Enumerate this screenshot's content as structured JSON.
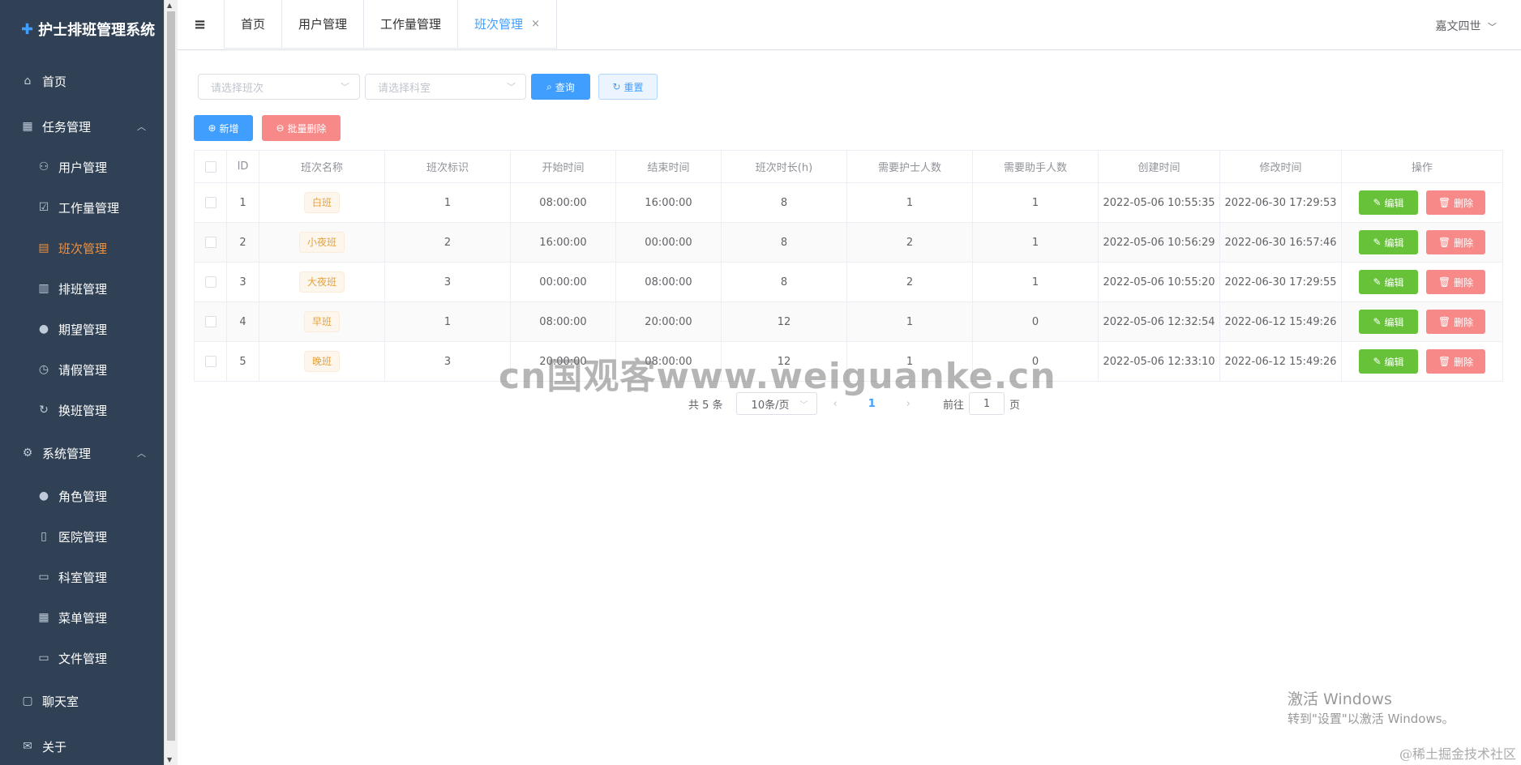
{
  "app": {
    "title": "护士排班管理系统",
    "user": "嘉文四世"
  },
  "sidebar": {
    "items": [
      {
        "label": "首页",
        "icon": "home-icon"
      },
      {
        "label": "任务管理",
        "icon": "grid-icon"
      },
      {
        "label": "用户管理",
        "icon": "user-icon"
      },
      {
        "label": "工作量管理",
        "icon": "clipboard-check-icon"
      },
      {
        "label": "班次管理",
        "icon": "clipboard-icon"
      },
      {
        "label": "排班管理",
        "icon": "calendar-icon"
      },
      {
        "label": "期望管理",
        "icon": "location-icon"
      },
      {
        "label": "请假管理",
        "icon": "clock-icon"
      },
      {
        "label": "换班管理",
        "icon": "refresh-icon"
      },
      {
        "label": "系统管理",
        "icon": "gear-icon"
      },
      {
        "label": "角色管理",
        "icon": "person-icon"
      },
      {
        "label": "医院管理",
        "icon": "building-icon"
      },
      {
        "label": "科室管理",
        "icon": "office-icon"
      },
      {
        "label": "菜单管理",
        "icon": "menu-icon"
      },
      {
        "label": "文件管理",
        "icon": "folder-icon"
      },
      {
        "label": "聊天室",
        "icon": "chat-icon"
      },
      {
        "label": "关于",
        "icon": "mail-icon"
      }
    ]
  },
  "tabs": [
    {
      "label": "首页"
    },
    {
      "label": "用户管理"
    },
    {
      "label": "工作量管理"
    },
    {
      "label": "班次管理"
    }
  ],
  "filters": {
    "shift_placeholder": "请选择班次",
    "dept_placeholder": "请选择科室",
    "query_label": "查询",
    "reset_label": "重置"
  },
  "actions": {
    "add_label": "新增",
    "batch_delete_label": "批量删除"
  },
  "table": {
    "headers": [
      "ID",
      "班次名称",
      "班次标识",
      "开始时间",
      "结束时间",
      "班次时长(h)",
      "需要护士人数",
      "需要助手人数",
      "创建时间",
      "修改时间",
      "操作"
    ],
    "edit_label": "编辑",
    "delete_label": "删除",
    "rows": [
      {
        "id": "1",
        "name": "白班",
        "flag": "1",
        "start": "08:00:00",
        "end": "16:00:00",
        "hours": "8",
        "nurses": "1",
        "assistants": "1",
        "created": "2022-05-06 10:55:35",
        "modified": "2022-06-30 17:29:53"
      },
      {
        "id": "2",
        "name": "小夜班",
        "flag": "2",
        "start": "16:00:00",
        "end": "00:00:00",
        "hours": "8",
        "nurses": "2",
        "assistants": "1",
        "created": "2022-05-06 10:56:29",
        "modified": "2022-06-30 16:57:46"
      },
      {
        "id": "3",
        "name": "大夜班",
        "flag": "3",
        "start": "00:00:00",
        "end": "08:00:00",
        "hours": "8",
        "nurses": "2",
        "assistants": "1",
        "created": "2022-05-06 10:55:20",
        "modified": "2022-06-30 17:29:55"
      },
      {
        "id": "4",
        "name": "早班",
        "flag": "1",
        "start": "08:00:00",
        "end": "20:00:00",
        "hours": "12",
        "nurses": "1",
        "assistants": "0",
        "created": "2022-05-06 12:32:54",
        "modified": "2022-06-12 15:49:26"
      },
      {
        "id": "5",
        "name": "晚班",
        "flag": "3",
        "start": "20:00:00",
        "end": "08:00:00",
        "hours": "12",
        "nurses": "1",
        "assistants": "0",
        "created": "2022-05-06 12:33:10",
        "modified": "2022-06-12 15:49:26"
      }
    ]
  },
  "pagination": {
    "total": "共 5 条",
    "page_size": "10条/页",
    "current": "1",
    "goto_prefix": "前往",
    "goto_value": "1",
    "goto_suffix": "页"
  },
  "watermarks": {
    "center": "cn国观客www.weiguanke.cn",
    "win_title": "激活 Windows",
    "win_sub": "转到\"设置\"以激活 Windows。",
    "juejin": "@稀土掘金技术社区"
  }
}
